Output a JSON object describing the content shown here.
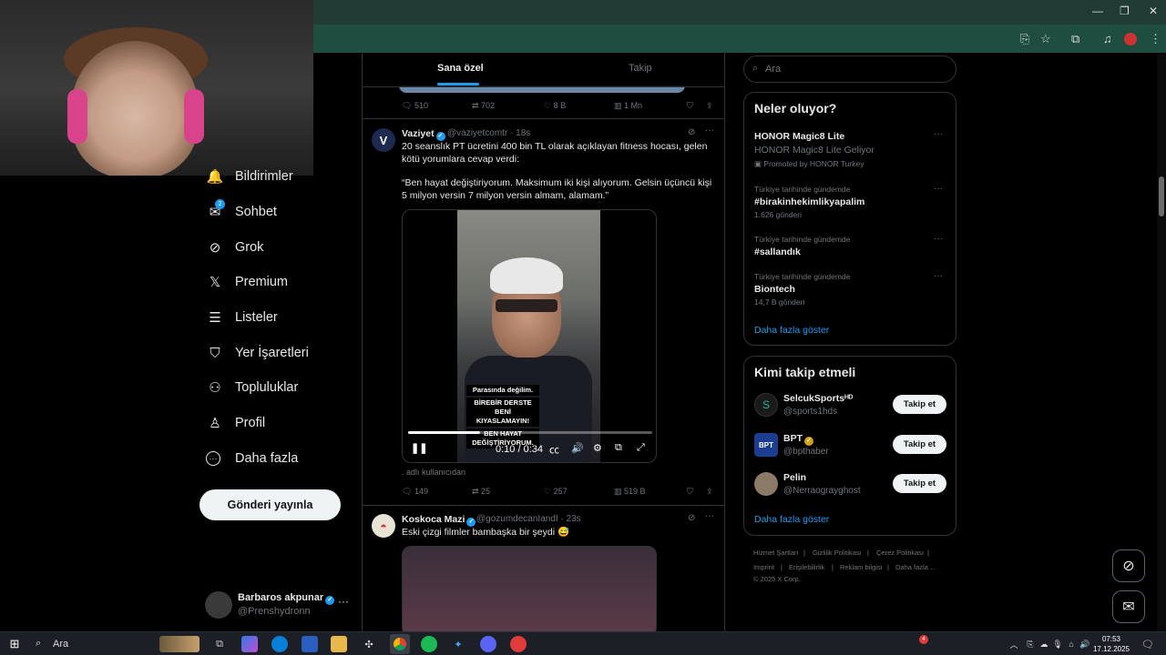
{
  "window": {
    "minimize": "—",
    "restore": "❐",
    "close": "✕"
  },
  "nav": {
    "items": [
      {
        "label": "Bildirimler",
        "icon": "bell-icon",
        "glyph": "🔔"
      },
      {
        "label": "Sohbet",
        "icon": "mail-icon",
        "glyph": "✉",
        "badge": "2"
      },
      {
        "label": "Grok",
        "icon": "grok-icon",
        "glyph": "⊘"
      },
      {
        "label": "Premium",
        "icon": "x-logo-icon",
        "glyph": "𝕏"
      },
      {
        "label": "Listeler",
        "icon": "list-icon",
        "glyph": "☰"
      },
      {
        "label": "Yer İşaretleri",
        "icon": "bookmark-icon",
        "glyph": "🔖"
      },
      {
        "label": "Topluluklar",
        "icon": "communities-icon",
        "glyph": "👥"
      },
      {
        "label": "Profil",
        "icon": "person-icon",
        "glyph": "👤"
      },
      {
        "label": "Daha fazla",
        "icon": "more-circle-icon",
        "glyph": "⋯"
      }
    ],
    "post_button": "Gönderi yayınla",
    "account": {
      "name": "Barbaros akpunar",
      "handle": "@Prenshydronn",
      "more": "···"
    }
  },
  "feed": {
    "tabs": [
      {
        "label": "Sana özel",
        "active": true
      },
      {
        "label": "Takip",
        "active": false
      }
    ],
    "prev_actions": {
      "replies": "510",
      "reposts": "702",
      "likes": "8 B",
      "views": "1 Mn"
    },
    "tweet1": {
      "avatar_letter": "V",
      "name": "Vaziyet",
      "handle": "@vaziyetcomtr",
      "time": "· 18s",
      "text1": "20 seanslık PT ücretini 400 bin TL olarak açıklayan fitness hocası, gelen kötü yorumlara cevap verdi:",
      "text2": "“Ben hayat değiştiriyorum. Maksimum iki kişi alıyorum. Gelsin üçüncü kişi 5 milyon versin 7 milyon versin almam, alamam.”",
      "video": {
        "overlay": [
          "Parasında değilim.",
          "BİREBİR DERSTE BENİ KIYASLAMAYIN!",
          "BEN HAYAT DEĞİŞTİRİYORUM."
        ],
        "time": "0:10 / 0:34",
        "progress": 0.294
      },
      "source": ". adlı kullanıcıdan",
      "actions": {
        "replies": "149",
        "reposts": "25",
        "likes": "257",
        "views": "519 B"
      }
    },
    "tweet2": {
      "name": "Koskoca Mazi",
      "handle": "@gozumdecanIandI",
      "time": "· 23s",
      "text": "Eski çizgi filmler bambaşka bir şeydi 😅"
    }
  },
  "sidebar": {
    "search_placeholder": "Ara",
    "trends_title": "Neler oluyor?",
    "promo": {
      "title": "HONOR Magic8 Lite",
      "subtitle": "HONOR Magic8 Lite Geliyor",
      "promoted": "Promoted by HONOR Turkey"
    },
    "trends": [
      {
        "context": "Türkiye tarihinde gündemde",
        "name": "#birakinhekimlikyapalim",
        "count": "1.626 gönderi"
      },
      {
        "context": "Türkiye tarihinde gündemde",
        "name": "#sallandık",
        "count": ""
      },
      {
        "context": "Türkiye tarihinde gündemde",
        "name": "Biontech",
        "count": "14,7 B gönderi"
      }
    ],
    "show_more": "Daha fazla göster",
    "who_title": "Kimi takip etmeli",
    "who": [
      {
        "name": "SelcukSportsᴴᴰ",
        "handle": "@sports1hds",
        "button": "Takip et",
        "avatar_color": "#1a1a1a"
      },
      {
        "name": "BPT",
        "handle": "@bpthaber",
        "button": "Takip et",
        "avatar_color": "#1b3c8f",
        "avatar_text": "BPT"
      },
      {
        "name": "Pelin",
        "handle": "@Nerraograyghost",
        "button": "Takip et",
        "avatar_color": "#8a7a66"
      }
    ],
    "who_more": "Daha fazla göster",
    "footer": [
      "Hizmet Şartları",
      "|",
      "Gizlilik Politikası",
      "|",
      "Çerez Politikası",
      "|",
      "Imprint",
      "|",
      "Erişilebilirlik",
      "|",
      "Reklam bilgisi",
      "|",
      "Daha fazla ...",
      "© 2025 X Corp."
    ]
  },
  "taskbar": {
    "search": "Ara",
    "time": "07:53",
    "date": "17.12.2025",
    "notification_badge": "4"
  }
}
